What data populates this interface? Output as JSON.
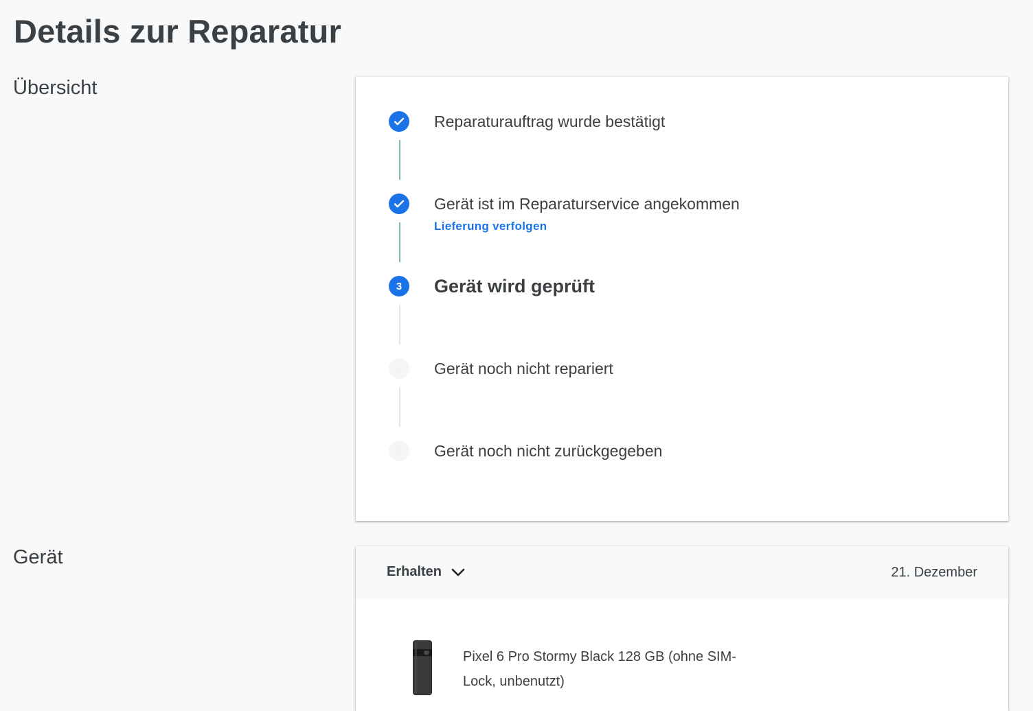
{
  "page": {
    "title": "Details zur Reparatur"
  },
  "sections": {
    "overview_label": "Übersicht",
    "device_label": "Gerät"
  },
  "timeline": {
    "steps": [
      {
        "label": "Reparaturauftrag wurde bestätigt",
        "state": "done",
        "icon": "check-icon"
      },
      {
        "label": "Gerät ist im Reparaturservice angekommen",
        "state": "done",
        "icon": "check-icon",
        "link": "Lieferung verfolgen"
      },
      {
        "label": "Gerät wird geprüft",
        "state": "active",
        "number": "3"
      },
      {
        "label": "Gerät noch nicht repariert",
        "state": "pending",
        "number": "4"
      },
      {
        "label": "Gerät noch nicht zurückgegeben",
        "state": "pending",
        "number": "5"
      }
    ]
  },
  "device": {
    "status_label": "Erhalten",
    "status_icon": "chevron-down-icon",
    "date": "21. Dezember",
    "product_name": "Pixel 6 Pro Stormy Black 128 GB (ohne SIM-Lock, unbenutzt)",
    "image_icon": "phone-image"
  },
  "colors": {
    "accent": "#1a73e8",
    "background": "#f8f9fa",
    "text": "#3c4043",
    "connector_done": "#7fb6b2"
  }
}
